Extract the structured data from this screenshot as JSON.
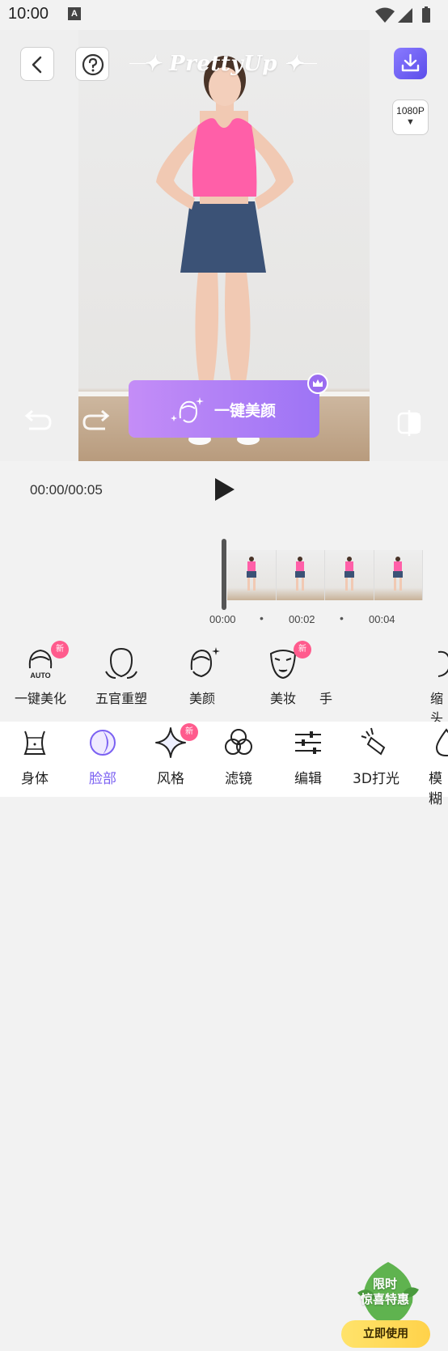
{
  "status_bar": {
    "time": "10:00",
    "notification_icon": "A"
  },
  "header": {
    "logo": "✦ PrettyUp ✦",
    "resolution": "1080P",
    "resolution_arrow": "▼"
  },
  "beauty_button": {
    "label": "一键美颜"
  },
  "player": {
    "timecode": "00:00/00:05"
  },
  "timeline": {
    "ticks": [
      "00:00",
      "00:02",
      "00:04"
    ],
    "dot": "•"
  },
  "tools": [
    {
      "label": "一键美化",
      "icon": "face-auto-icon",
      "badge": "新"
    },
    {
      "label": "五官重塑",
      "icon": "face-outline-icon"
    },
    {
      "label": "美颜",
      "icon": "face-sparkle-icon"
    },
    {
      "label": "美妆",
      "icon": "makeup-icon",
      "badge": "新"
    },
    {
      "label": "手",
      "icon": "hand-icon"
    },
    {
      "label": "缩头",
      "icon": "shrink-head-icon"
    }
  ],
  "promo": {
    "line1": "限时",
    "line2": "惊喜特惠",
    "button": "立即使用"
  },
  "tabs": [
    {
      "label": "身体",
      "icon": "body-icon"
    },
    {
      "label": "脸部",
      "icon": "face-icon",
      "active": true
    },
    {
      "label": "风格",
      "icon": "sparkle-icon",
      "badge": "新"
    },
    {
      "label": "滤镜",
      "icon": "filter-icon"
    },
    {
      "label": "编辑",
      "icon": "sliders-icon"
    },
    {
      "label": "3D打光",
      "icon": "light-icon"
    },
    {
      "label": "模糊",
      "icon": "blur-icon"
    }
  ],
  "colors": {
    "accent": "#7b61f2",
    "badge": "#ff5b8d",
    "promo_green": "#5fb34f",
    "promo_yellow": "#ffd84e"
  }
}
